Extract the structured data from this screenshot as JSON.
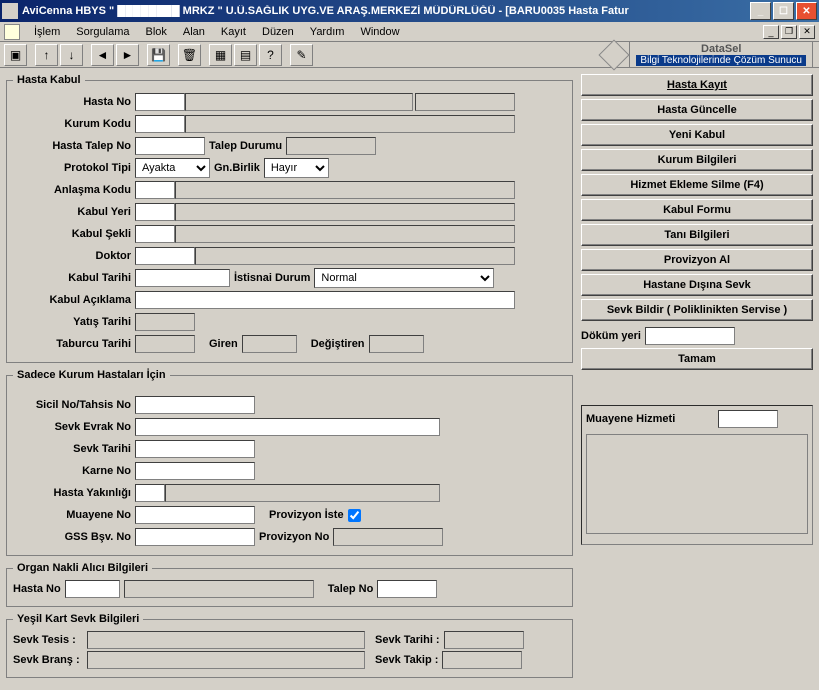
{
  "title": "AviCenna HBYS \" ████████ MRKZ \" U.Ü.SAĞLIK UYG.VE ARAŞ.MERKEZİ MÜDÜRLÜĞÜ - [BARU0035 Hasta Fatur",
  "menu": [
    "İşlem",
    "Sorgulama",
    "Blok",
    "Alan",
    "Kayıt",
    "Düzen",
    "Yardım",
    "Window"
  ],
  "logo": {
    "brand": "DataSel",
    "tag": "Bilgi Teknolojilerinde Çözüm Sunucu"
  },
  "hasta_kabul": {
    "legend": "Hasta Kabul",
    "labels": {
      "hasta_no": "Hasta No",
      "kurum_kodu": "Kurum Kodu",
      "hasta_talep_no": "Hasta Talep No",
      "talep_durumu": "Talep Durumu",
      "protokol_tipi": "Protokol Tipi",
      "gn_birlik": "Gn.Birlik",
      "anlasma_kodu": "Anlaşma Kodu",
      "kabul_yeri": "Kabul Yeri",
      "kabul_sekli": "Kabul Şekli",
      "doktor": "Doktor",
      "kabul_tarihi": "Kabul Tarihi",
      "istisnai_durum": "İstisnai Durum",
      "kabul_aciklama": "Kabul Açıklama",
      "yatis_tarihi": "Yatış Tarihi",
      "taburcu_tarihi": "Taburcu Tarihi",
      "giren": "Giren",
      "degistiren": "Değiştiren"
    },
    "protokol_tipi_value": "Ayakta",
    "gn_birlik_value": "Hayır",
    "istisnai_durum_value": "Normal"
  },
  "kurum_ozel": {
    "legend": "Sadece Kurum Hastaları İçin",
    "labels": {
      "sicil": "Sicil No/Tahsis No",
      "sevk_evrak": "Sevk Evrak No",
      "sevk_tarihi": "Sevk Tarihi",
      "karne_no": "Karne No",
      "hasta_yakinligi": "Hasta Yakınlığı",
      "muayene_no": "Muayene No",
      "provizyon_iste": "Provizyon İste",
      "gss_bsv": "GSS Bşv. No",
      "provizyon_no": "Provizyon No"
    },
    "provizyon_iste_checked": true
  },
  "organ": {
    "legend": "Organ Nakli Alıcı Bilgileri",
    "labels": {
      "hasta_no": "Hasta No",
      "talep_no": "Talep No"
    }
  },
  "yesilkart": {
    "legend": "Yeşil Kart Sevk Bilgileri",
    "labels": {
      "sevk_tesis": "Sevk Tesis :",
      "sevk_brans": "Sevk Branş :",
      "sevk_tarihi": "Sevk Tarihi :",
      "sevk_takip": "Sevk Takip :"
    }
  },
  "right": {
    "buttons": {
      "hasta_kayit": "Hasta Kayıt",
      "hasta_guncelle": "Hasta Güncelle",
      "yeni_kabul": "Yeni Kabul",
      "kurum_bilgileri": "Kurum Bilgileri",
      "hizmet_ekleme": "Hizmet Ekleme Silme (F4)",
      "kabul_formu": "Kabul Formu",
      "tani_bilgileri": "Tanı Bilgileri",
      "provizyon_al": "Provizyon Al",
      "hastane_disina": "Hastane Dışına Sevk",
      "sevk_bildir": "Sevk Bildir ( Poliklinikten Servise )",
      "tamam": "Tamam"
    },
    "dokum_yeri": "Döküm yeri",
    "muayene_hizmeti": "Muayene Hizmeti"
  },
  "icons": {
    "exec": "▣",
    "up": "↑",
    "dn": "↓",
    "left": "◄",
    "right": "►",
    "save": "💾",
    "del": "🗑",
    "doc1": "▦",
    "doc2": "▤",
    "help": "?",
    "notes": "✎"
  }
}
